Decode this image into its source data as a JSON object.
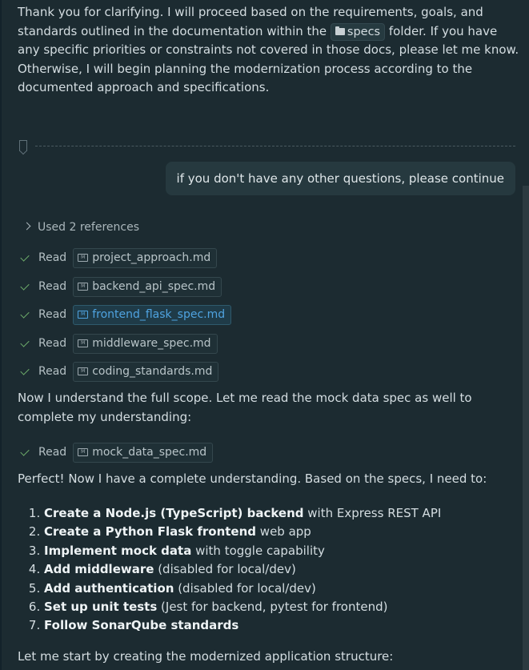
{
  "intro": {
    "part1": "Thank you for clarifying. I will proceed based on the requirements, goals, and standards outlined in the documentation within the ",
    "chip": "specs",
    "part2": " folder. If you have any specific priorities or constraints not covered in those docs, please let me know. Otherwise, I will begin planning the modernization process according to the documented approach and specifications."
  },
  "user_message": "if you don't have any other questions, please continue",
  "references_label": "Used 2 references",
  "read_label": "Read",
  "reads": [
    {
      "file": "project_approach.md",
      "active": false
    },
    {
      "file": "backend_api_spec.md",
      "active": false
    },
    {
      "file": "frontend_flask_spec.md",
      "active": true
    },
    {
      "file": "middleware_spec.md",
      "active": false
    },
    {
      "file": "coding_standards.md",
      "active": false
    }
  ],
  "understand_text": "Now I understand the full scope. Let me read the mock data spec as well to complete my understanding:",
  "mock_read": {
    "file": "mock_data_spec.md"
  },
  "perfect_text": "Perfect! Now I have a complete understanding. Based on the specs, I need to:",
  "steps": [
    {
      "bold": "Create a Node.js (TypeScript) backend",
      "rest": " with Express REST API"
    },
    {
      "bold": "Create a Python Flask frontend",
      "rest": " web app"
    },
    {
      "bold": "Implement mock data",
      "rest": " with toggle capability"
    },
    {
      "bold": "Add middleware",
      "rest": " (disabled for local/dev)"
    },
    {
      "bold": "Add authentication",
      "rest": " (disabled for local/dev)"
    },
    {
      "bold": "Set up unit tests",
      "rest": " (Jest for backend, pytest for frontend)"
    },
    {
      "bold": "Follow SonarQube standards",
      "rest": ""
    }
  ],
  "closing_text": "Let me start by creating the modernized application structure:"
}
